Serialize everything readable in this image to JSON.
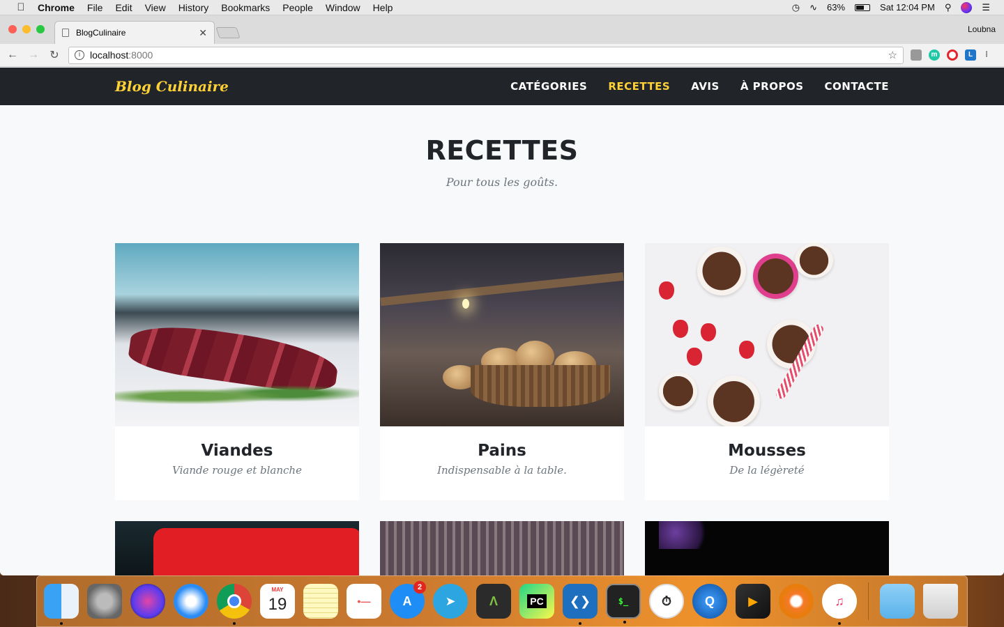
{
  "menubar": {
    "app_name": "Chrome",
    "items": [
      "File",
      "Edit",
      "View",
      "History",
      "Bookmarks",
      "People",
      "Window",
      "Help"
    ],
    "battery": "63%",
    "battery_level": 0.63,
    "clock": "Sat 12:04 PM"
  },
  "browser": {
    "tab_title": "BlogCulinaire",
    "profile_name": "Loubna",
    "url_host": "localhost",
    "url_port": ":8000"
  },
  "site": {
    "brand": "Blog Culinaire",
    "nav": [
      {
        "label": "CATÉGORIES",
        "active": false
      },
      {
        "label": "RECETTES",
        "active": true
      },
      {
        "label": "AVIS",
        "active": false
      },
      {
        "label": "À PROPOS",
        "active": false
      },
      {
        "label": "CONTACTE",
        "active": false
      }
    ],
    "section_title": "RECETTES",
    "section_subtitle": "Pour tous les goûts.",
    "cards": [
      {
        "title": "Viandes",
        "subtitle": "Viande rouge et blanche"
      },
      {
        "title": "Pains",
        "subtitle": "Indispensable à la table."
      },
      {
        "title": "Mousses",
        "subtitle": "De la légèreté"
      }
    ]
  },
  "dock": {
    "calendar_month": "MAY",
    "calendar_day": "19",
    "app_store_badge": "2"
  },
  "colors": {
    "accent": "#fed136",
    "navbar": "#212529",
    "page_bg": "#f8f9fa"
  }
}
